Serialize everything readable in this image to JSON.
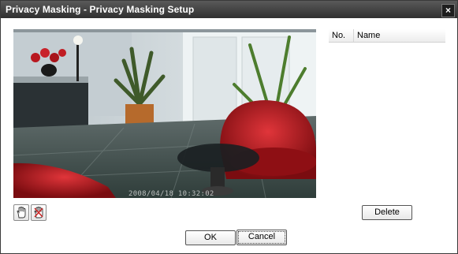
{
  "window": {
    "title": "Privacy Masking - Privacy Masking Setup",
    "close_glyph": "×"
  },
  "video": {
    "timestamp": "2008/04/18 10:32:02"
  },
  "toolbar": {
    "draw_tool_icon": "hand-icon",
    "remove_tool_icon": "hand-remove-icon"
  },
  "mask_list": {
    "columns": [
      "No.",
      "Name"
    ],
    "rows": []
  },
  "buttons": {
    "delete": "Delete",
    "ok": "OK",
    "cancel": "Cancel"
  },
  "colors": {
    "titlebar": "#3a3a3a",
    "chair": "#b8161b"
  }
}
